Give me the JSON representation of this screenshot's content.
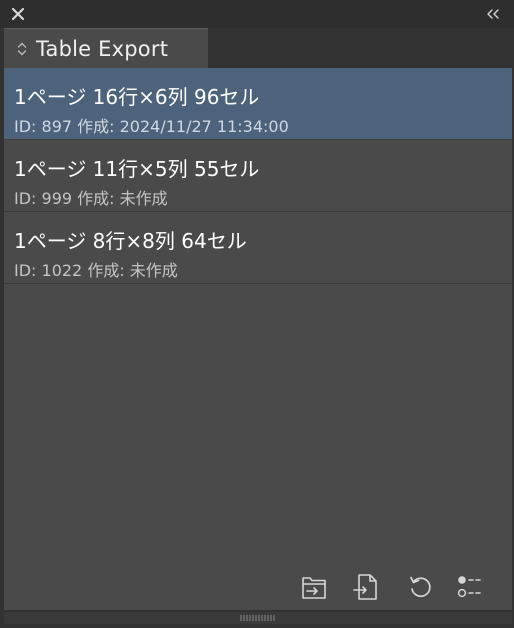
{
  "window": {
    "close_icon": "close-icon",
    "collapse_icon": "double-chevron-left-icon"
  },
  "tab": {
    "label": "Table Export",
    "icon": "sort-updown-icon"
  },
  "items": [
    {
      "title": "1ページ  16行×6列  96セル",
      "meta": "ID: 897  作成: 2024/11/27 11:34:00",
      "selected": true
    },
    {
      "title": "1ページ  11行×5列  55セル",
      "meta": "ID: 999  作成: 未作成",
      "selected": false
    },
    {
      "title": "1ページ  8行×8列  64セル",
      "meta": "ID: 1022  作成: 未作成",
      "selected": false
    }
  ],
  "footer": {
    "buttons": [
      "export-folder-icon",
      "export-file-icon",
      "refresh-icon",
      "list-options-icon"
    ]
  },
  "colors": {
    "panel_bg": "#4a4a4a",
    "selected_bg": "#4c637b",
    "text": "#ffffff",
    "subtext": "#c4c4c4"
  }
}
